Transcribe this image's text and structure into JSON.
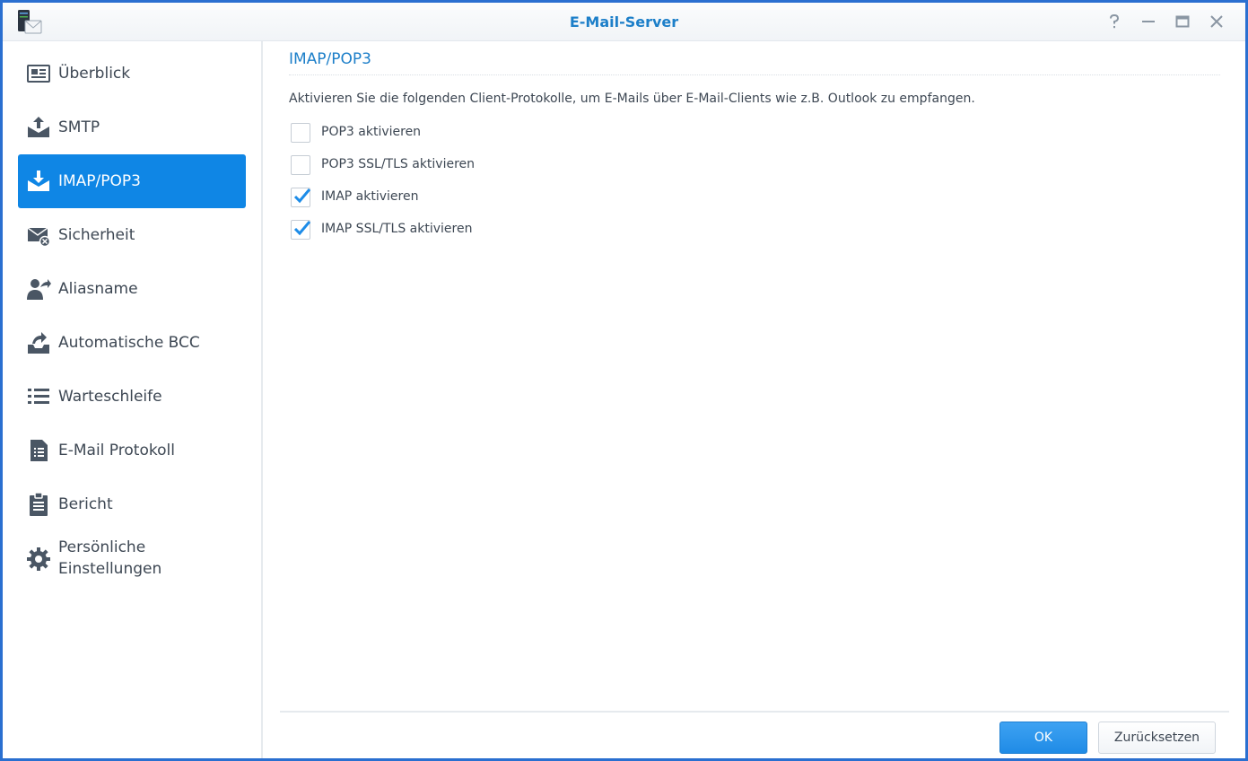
{
  "window": {
    "title": "E-Mail-Server",
    "controls": {
      "help": "help-icon",
      "minimize": "minimize-icon",
      "maximize": "maximize-icon",
      "close": "close-icon"
    }
  },
  "sidebar": {
    "active_index": 2,
    "items": [
      {
        "label": "Überblick",
        "icon": "overview-icon"
      },
      {
        "label": "SMTP",
        "icon": "upload-mail-icon"
      },
      {
        "label": "IMAP/POP3",
        "icon": "download-mail-icon"
      },
      {
        "label": "Sicherheit",
        "icon": "mail-block-icon"
      },
      {
        "label": "Aliasname",
        "icon": "user-forward-icon"
      },
      {
        "label": "Automatische BCC",
        "icon": "auto-bcc-icon"
      },
      {
        "label": "Warteschleife",
        "icon": "list-icon"
      },
      {
        "label": "E-Mail Protokoll",
        "icon": "log-document-icon"
      },
      {
        "label": "Bericht",
        "icon": "clipboard-icon"
      },
      {
        "label": "Persönliche Einstellungen",
        "icon": "gear-icon"
      }
    ]
  },
  "main": {
    "section_title": "IMAP/POP3",
    "description": "Aktivieren Sie die folgenden Client-Protokolle, um E-Mails über E-Mail-Clients wie z.B. Outlook zu empfangen.",
    "options": [
      {
        "label": "POP3 aktivieren",
        "checked": false
      },
      {
        "label": "POP3 SSL/TLS aktivieren",
        "checked": false
      },
      {
        "label": "IMAP aktivieren",
        "checked": true
      },
      {
        "label": "IMAP SSL/TLS aktivieren",
        "checked": true
      }
    ]
  },
  "footer": {
    "ok_label": "OK",
    "reset_label": "Zurücksetzen"
  },
  "colors": {
    "accent": "#0f86e5",
    "title": "#1d7fc9",
    "text": "#3d4753",
    "icon": "#4a5664",
    "check": "#1d8ce8"
  }
}
